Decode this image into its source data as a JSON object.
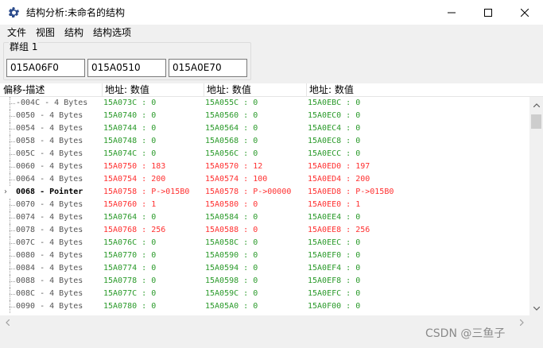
{
  "window": {
    "title": "结构分析:未命名的结构",
    "icon": "gear-app-icon"
  },
  "menu": {
    "items": [
      {
        "label": "文件"
      },
      {
        "label": "视图"
      },
      {
        "label": "结构"
      },
      {
        "label": "结构选项"
      }
    ]
  },
  "group": {
    "title": "群组 1",
    "addresses": [
      "015A06F0",
      "015A0510",
      "015A0E70"
    ]
  },
  "columns": {
    "desc": "偏移-描述",
    "addr1": "地址: 数值",
    "addr2": "地址: 数值",
    "addr3": "地址: 数值"
  },
  "rows": [
    {
      "desc": "-004C - 4 Bytes",
      "c1": "15A073C : 0",
      "c2": "15A055C : 0",
      "c3": "15A0EBC : 0",
      "status": "same",
      "bold": false,
      "expandable": false
    },
    {
      "desc": "0050 - 4 Bytes",
      "c1": "15A0740 : 0",
      "c2": "15A0560 : 0",
      "c3": "15A0EC0 : 0",
      "status": "same",
      "bold": false,
      "expandable": false
    },
    {
      "desc": "0054 - 4 Bytes",
      "c1": "15A0744 : 0",
      "c2": "15A0564 : 0",
      "c3": "15A0EC4 : 0",
      "status": "same",
      "bold": false,
      "expandable": false
    },
    {
      "desc": "0058 - 4 Bytes",
      "c1": "15A0748 : 0",
      "c2": "15A0568 : 0",
      "c3": "15A0EC8 : 0",
      "status": "same",
      "bold": false,
      "expandable": false
    },
    {
      "desc": "005C - 4 Bytes",
      "c1": "15A074C : 0",
      "c2": "15A056C : 0",
      "c3": "15A0ECC : 0",
      "status": "same",
      "bold": false,
      "expandable": false
    },
    {
      "desc": "0060 - 4 Bytes",
      "c1": "15A0750 : 183",
      "c2": "15A0570 : 12",
      "c3": "15A0ED0 : 197",
      "status": "diff",
      "bold": false,
      "expandable": false
    },
    {
      "desc": "0064 - 4 Bytes",
      "c1": "15A0754 : 200",
      "c2": "15A0574 : 100",
      "c3": "15A0ED4 : 200",
      "status": "diff",
      "bold": false,
      "expandable": false
    },
    {
      "desc": "0068 - Pointer",
      "c1": "15A0758 : P->015B0",
      "c2": "15A0578 : P->00000",
      "c3": "15A0ED8 : P->015B0",
      "status": "diff",
      "bold": true,
      "expandable": true
    },
    {
      "desc": "0070 - 4 Bytes",
      "c1": "15A0760 : 1",
      "c2": "15A0580 : 0",
      "c3": "15A0EE0 : 1",
      "status": "diff",
      "bold": false,
      "expandable": false
    },
    {
      "desc": "0074 - 4 Bytes",
      "c1": "15A0764 : 0",
      "c2": "15A0584 : 0",
      "c3": "15A0EE4 : 0",
      "status": "same",
      "bold": false,
      "expandable": false
    },
    {
      "desc": "0078 - 4 Bytes",
      "c1": "15A0768 : 256",
      "c2": "15A0588 : 0",
      "c3": "15A0EE8 : 256",
      "status": "diff",
      "bold": false,
      "expandable": false
    },
    {
      "desc": "007C - 4 Bytes",
      "c1": "15A076C : 0",
      "c2": "15A058C : 0",
      "c3": "15A0EEC : 0",
      "status": "same",
      "bold": false,
      "expandable": false
    },
    {
      "desc": "0080 - 4 Bytes",
      "c1": "15A0770 : 0",
      "c2": "15A0590 : 0",
      "c3": "15A0EF0 : 0",
      "status": "same",
      "bold": false,
      "expandable": false
    },
    {
      "desc": "0084 - 4 Bytes",
      "c1": "15A0774 : 0",
      "c2": "15A0594 : 0",
      "c3": "15A0EF4 : 0",
      "status": "same",
      "bold": false,
      "expandable": false
    },
    {
      "desc": "0088 - 4 Bytes",
      "c1": "15A0778 : 0",
      "c2": "15A0598 : 0",
      "c3": "15A0EF8 : 0",
      "status": "same",
      "bold": false,
      "expandable": false
    },
    {
      "desc": "008C - 4 Bytes",
      "c1": "15A077C : 0",
      "c2": "15A059C : 0",
      "c3": "15A0EFC : 0",
      "status": "same",
      "bold": false,
      "expandable": false
    },
    {
      "desc": "0090 - 4 Bytes",
      "c1": "15A0780 : 0",
      "c2": "15A05A0 : 0",
      "c3": "15A0F00 : 0",
      "status": "same",
      "bold": false,
      "expandable": false
    }
  ],
  "colors": {
    "same": "#2a9a2a",
    "diff": "#ff3030"
  },
  "watermark": "CSDN @三鱼子"
}
